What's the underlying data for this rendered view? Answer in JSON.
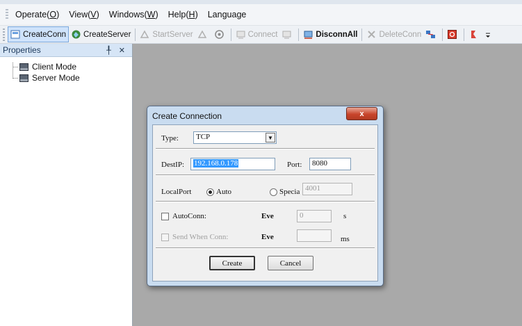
{
  "menu": {
    "items": [
      {
        "label": "Operate(",
        "key": "O",
        "suffix": ")"
      },
      {
        "label": "View(",
        "key": "V",
        "suffix": ")"
      },
      {
        "label": "Windows(",
        "key": "W",
        "suffix": ")"
      },
      {
        "label": "Help(",
        "key": "H",
        "suffix": ")"
      },
      {
        "label": "Language",
        "key": "",
        "suffix": ""
      }
    ]
  },
  "toolbar": {
    "create_conn": "CreateConn",
    "create_server": "CreateServer",
    "start_server": "StartServer",
    "connect": "Connect",
    "disconn_all": "DisconnAll",
    "delete_conn": "DeleteConn"
  },
  "properties": {
    "title": "Properties",
    "pin_close": "╀ ✕",
    "items": [
      "Client Mode",
      "Server Mode"
    ]
  },
  "dialog": {
    "title": "Create Connection",
    "close": "x",
    "type_label": "Type:",
    "type_value": "TCP",
    "destip_label": "DestIP:",
    "destip_value": "192.168.0.178",
    "port_label": "Port:",
    "port_value": "8080",
    "localport_label": "LocalPort",
    "auto_label": "Auto",
    "special_label": "Specia",
    "special_value": "4001",
    "autoconn_label": "AutoConn:",
    "eve_label": "Eve",
    "autoconn_value": "0",
    "autoconn_unit": "s",
    "sendwhen_label": "Send When Conn:",
    "eve2_label": "Eve",
    "sendwhen_value": "",
    "sendwhen_unit": "ms",
    "create_btn": "Create",
    "cancel_btn": "Cancel"
  }
}
